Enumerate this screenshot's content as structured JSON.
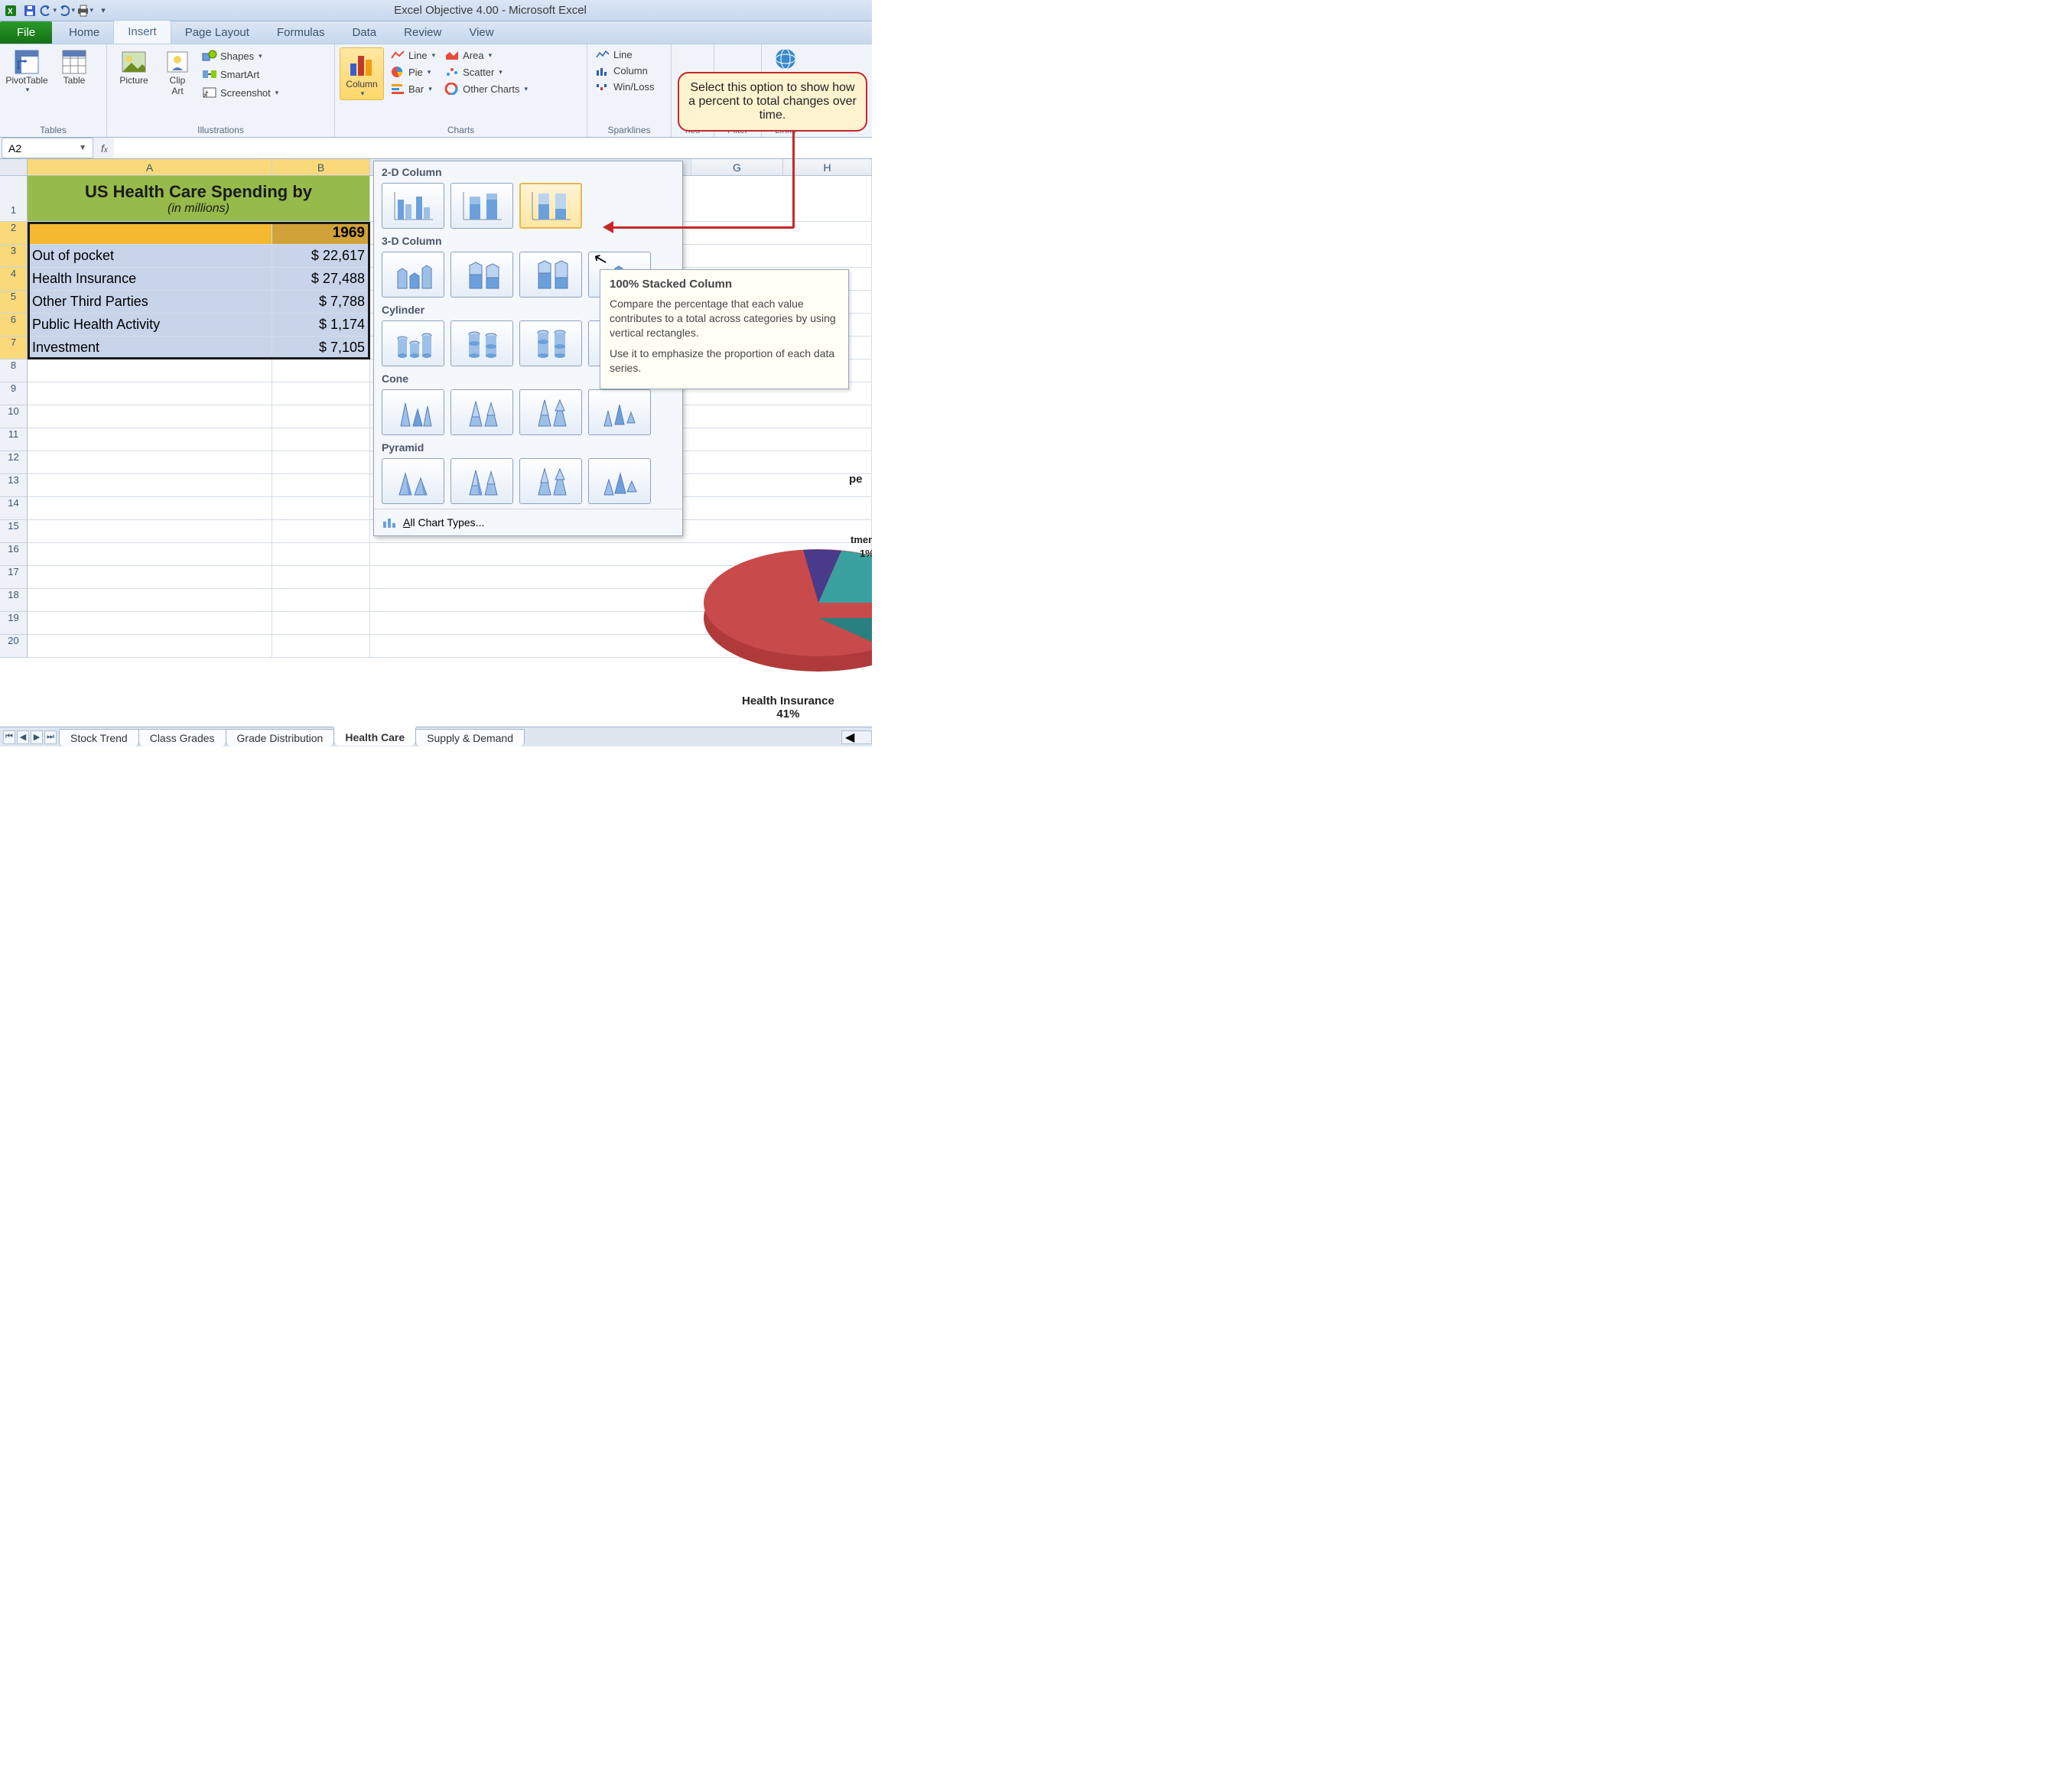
{
  "app_title": "Excel Objective 4.00  -  Microsoft Excel",
  "ribbon": {
    "file": "File",
    "tabs": [
      "Home",
      "Insert",
      "Page Layout",
      "Formulas",
      "Data",
      "Review",
      "View"
    ],
    "active_tab": "Insert",
    "groups": {
      "tables": {
        "label": "Tables",
        "pivot": "PivotTable",
        "table": "Table"
      },
      "illustrations": {
        "label": "Illustrations",
        "picture": "Picture",
        "clipart": "Clip\nArt",
        "shapes": "Shapes",
        "smartart": "SmartArt",
        "screenshot": "Screenshot"
      },
      "charts": {
        "label": "Charts",
        "column": "Column",
        "line": "Line",
        "pie": "Pie",
        "bar": "Bar",
        "area": "Area",
        "scatter": "Scatter",
        "other": "Other Charts"
      },
      "sparklines": {
        "label": "Sparklines",
        "line": "Line",
        "column": "Column",
        "winloss": "Win/Loss"
      },
      "stub1": "nes",
      "stub2": "Filter",
      "stub3": "Links"
    }
  },
  "namebox": "A2",
  "columns": [
    "A",
    "B",
    "G",
    "H"
  ],
  "sheet": {
    "title": "US Health Care Spending by",
    "subtitle": "(in millions)",
    "year": "1969",
    "rows": [
      {
        "label": "Out of pocket",
        "val": "$ 22,617"
      },
      {
        "label": "Health Insurance",
        "val": "$ 27,488"
      },
      {
        "label": "Other Third Parties",
        "val": "$   7,788"
      },
      {
        "label": "Public Health Activity",
        "val": "$   1,174"
      },
      {
        "label": "Investment",
        "val": "$   7,105"
      }
    ]
  },
  "dropdown": {
    "s1": "2-D Column",
    "s2": "3-D Column",
    "s3": "Cylinder",
    "s4": "Cone",
    "s5": "Pyramid",
    "footer": "All Chart Types..."
  },
  "tooltip": {
    "title": "100% Stacked Column",
    "p1": "Compare the percentage that each value contributes to a total across categories by using vertical rectangles.",
    "p2": "Use it to emphasize the proportion of each data series."
  },
  "callout": "Select this option to show how a percent to total changes over time.",
  "pie": {
    "label1": "Health Insurance",
    "label2": "41%",
    "frag1": "pe",
    "frag2": "tmen",
    "frag3": "1%"
  },
  "sheets": [
    "Stock Trend",
    "Class Grades",
    "Grade Distribution",
    "Health Care",
    "Supply & Demand"
  ],
  "active_sheet": "Health Care"
}
